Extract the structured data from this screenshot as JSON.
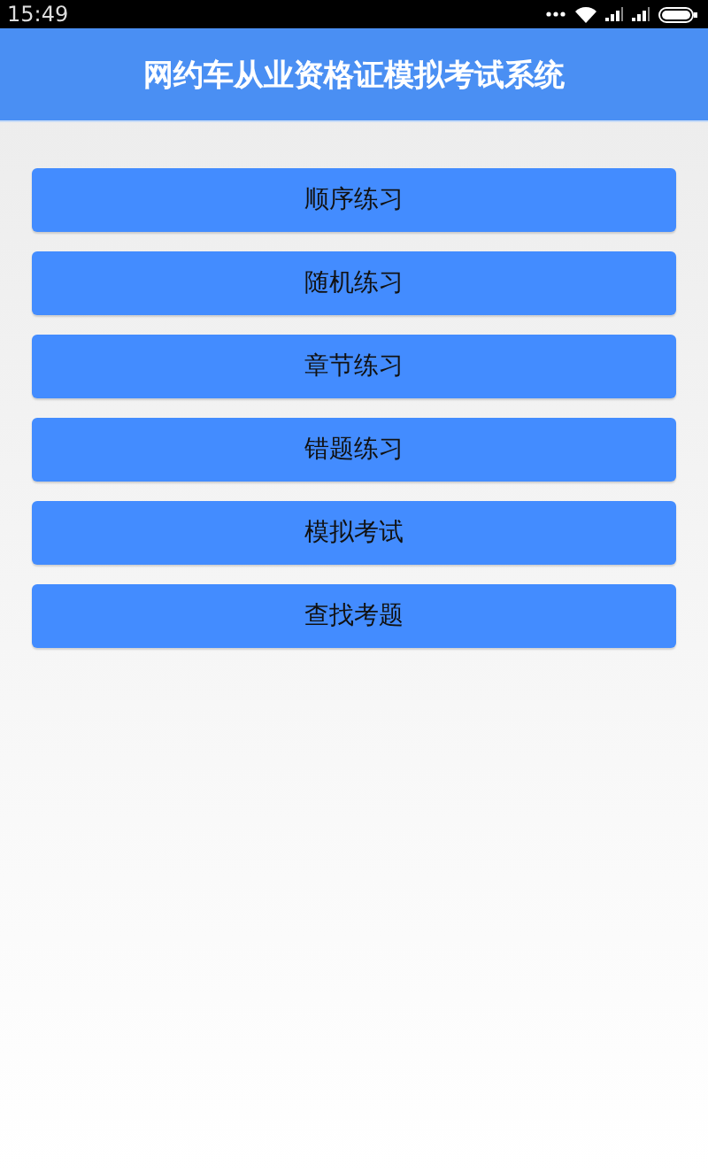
{
  "status_bar": {
    "time": "15:49"
  },
  "app_bar": {
    "title": "网约车从业资格证模拟考试系统"
  },
  "menu": [
    {
      "label": "顺序练习"
    },
    {
      "label": "随机练习"
    },
    {
      "label": "章节练习"
    },
    {
      "label": "错题练习"
    },
    {
      "label": "模拟考试"
    },
    {
      "label": "查找考题"
    }
  ]
}
